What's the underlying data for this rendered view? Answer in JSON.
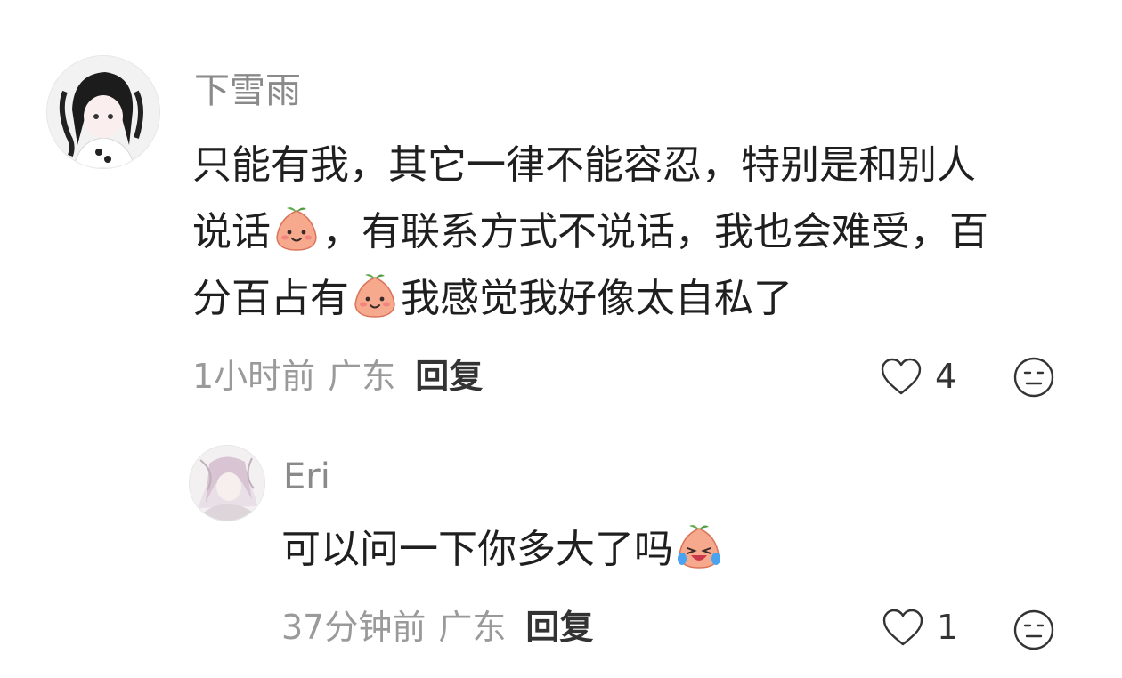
{
  "comments": [
    {
      "username": "下雪雨",
      "text_lines": [
        "只能有我，其它一律不能容忍，特别是和别人",
        "说话",
        "，有联系方式不说话，我也会难受，百",
        "分百占有",
        "我感觉我好像太自私了"
      ],
      "emoji": "smile-peach-emoji",
      "time": "1小时前",
      "location": "广东",
      "reply_label": "回复",
      "likes": "4"
    },
    {
      "username": "Eri",
      "text": "可以问一下你多大了吗",
      "emoji": "crying-laugh-peach-emoji",
      "time": "37分钟前",
      "location": "广东",
      "reply_label": "回复",
      "likes": "1"
    }
  ],
  "icons": {
    "like": "heart-outline-icon",
    "dislike": "neutral-face-icon"
  },
  "colors": {
    "username": "#8a8a8a",
    "text": "#1f1f1f",
    "meta": "#9a9a9a",
    "reply": "#333333"
  }
}
